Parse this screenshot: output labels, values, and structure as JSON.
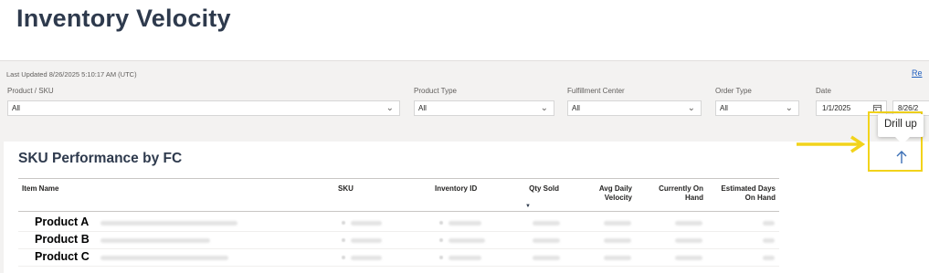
{
  "page": {
    "title": "Inventory Velocity"
  },
  "header": {
    "last_updated": "Last Updated 8/26/2025 5:10:17 AM (UTC)",
    "reset_link": "Re"
  },
  "slicers": {
    "product": {
      "label": "Product / SKU",
      "value": "All"
    },
    "product_type": {
      "label": "Product Type",
      "value": "All"
    },
    "fulfillment_center": {
      "label": "Fulfillment Center",
      "value": "All"
    },
    "order_type": {
      "label": "Order Type",
      "value": "All"
    },
    "date": {
      "label": "Date",
      "start": "1/1/2025",
      "end": "8/26/2"
    }
  },
  "visual": {
    "title": "SKU Performance by FC"
  },
  "table": {
    "columns": [
      "Item Name",
      "SKU",
      "Inventory ID",
      "Qty Sold",
      "Avg Daily\nVelocity",
      "Currently On\nHand",
      "Estimated Days\nOn Hand"
    ],
    "rows": [
      {
        "name": "Product A"
      },
      {
        "name": "Product B"
      },
      {
        "name": "Product C"
      }
    ]
  },
  "tooltip": {
    "text": "Drill up"
  },
  "icons": {
    "drill_up": "arrow-up-icon",
    "calendar": "calendar-icon",
    "dropdown": "chevron-down-icon"
  },
  "colors": {
    "highlight": "#f2d31b",
    "title": "#2e3a4d",
    "drill_arrow": "#3a6fb5"
  }
}
